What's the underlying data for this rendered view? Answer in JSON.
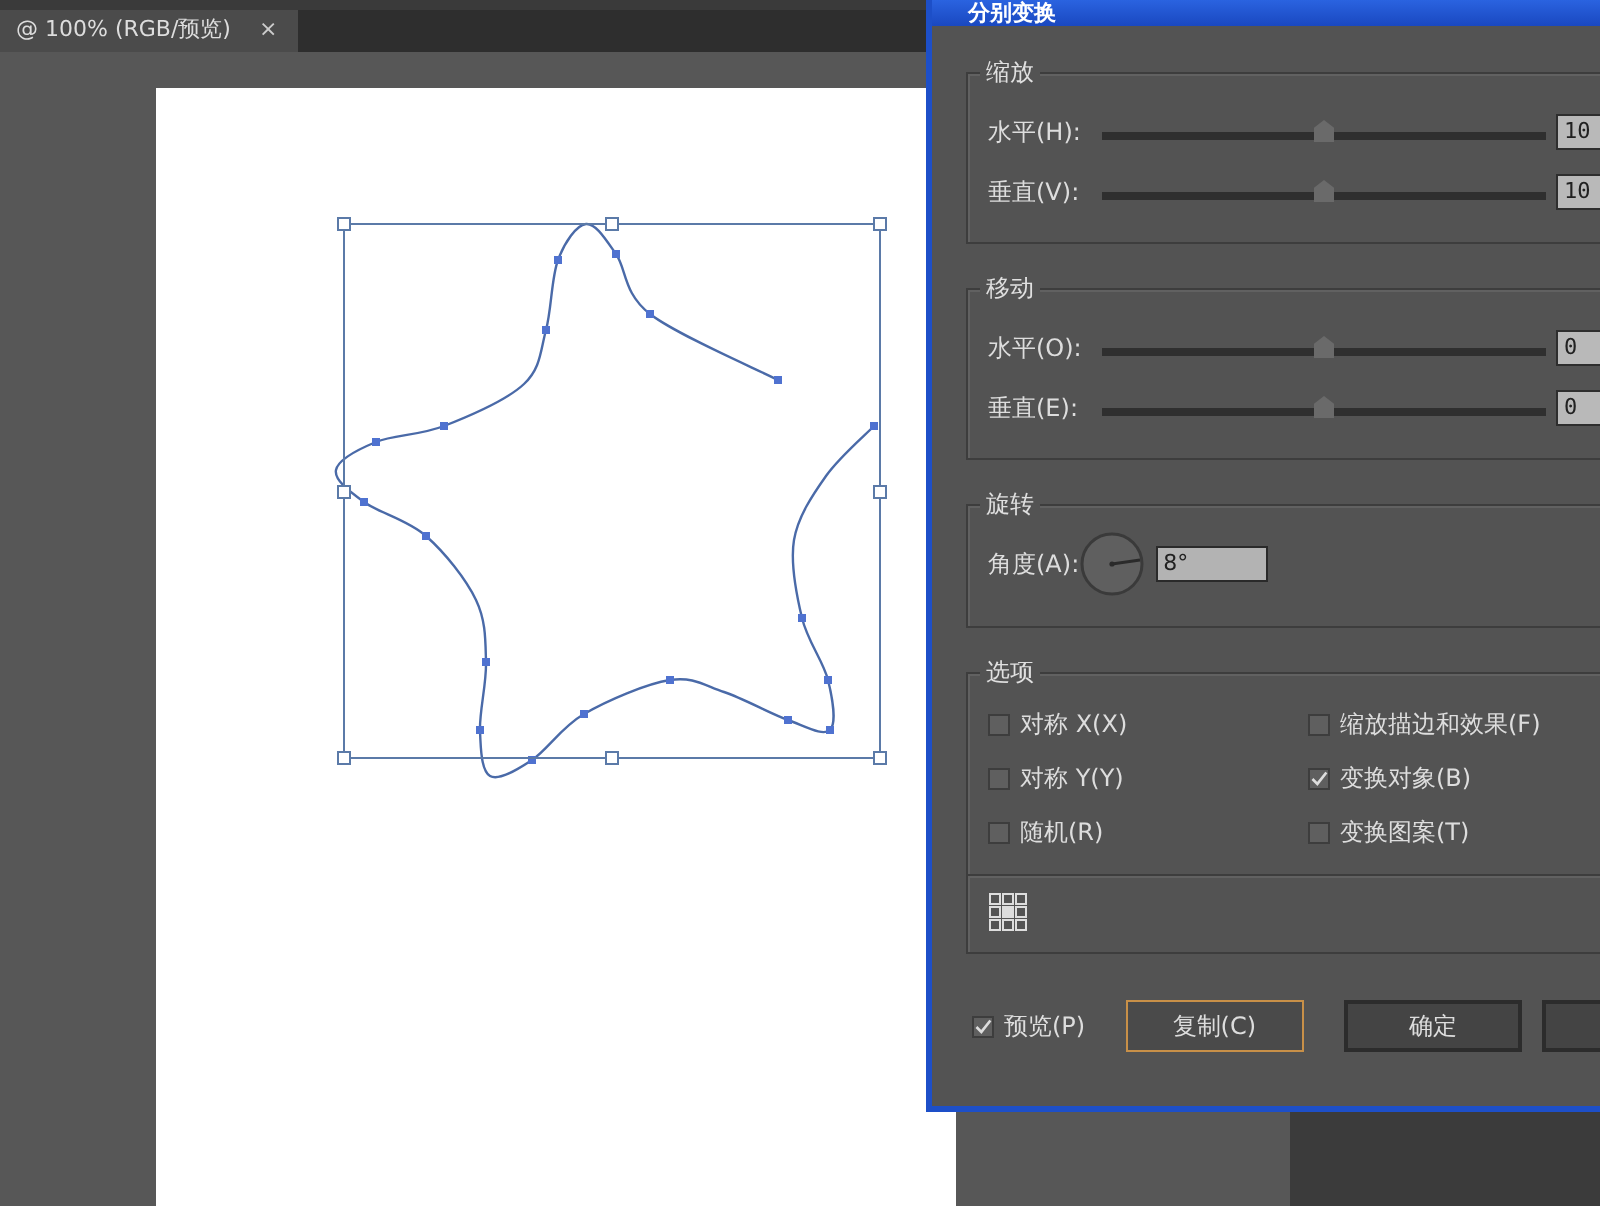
{
  "document_tab": {
    "label": "@ 100% (RGB/预览)",
    "close": "×"
  },
  "dialog": {
    "title": "分别变换",
    "scale": {
      "title": "缩放",
      "sliders": [
        {
          "label": "水平(H):",
          "level": 0.5,
          "value": "10"
        },
        {
          "label": "垂直(V):",
          "level": 0.5,
          "value": "10"
        }
      ]
    },
    "move": {
      "title": "移动",
      "sliders": [
        {
          "label": "水平(O):",
          "level": 0.5,
          "value": "0"
        },
        {
          "label": "垂直(E):",
          "level": 0.5,
          "value": "0"
        }
      ]
    },
    "rotate": {
      "title": "旋转",
      "label": "角度(A):",
      "value": "8°"
    },
    "options": {
      "title": "选项",
      "checkboxes": [
        {
          "label": "对称 X(X)",
          "checked": false
        },
        {
          "label": "缩放描边和效果(F)",
          "checked": false
        },
        {
          "label": "对称 Y(Y)",
          "checked": false
        },
        {
          "label": "变换对象(B)",
          "checked": true
        },
        {
          "label": "随机(R)",
          "checked": false
        },
        {
          "label": "变换图案(T)",
          "checked": false
        }
      ]
    },
    "preview": {
      "label": "预览(P)",
      "checked": true
    },
    "buttons": [
      {
        "label": "复制(C)",
        "focused": true
      },
      {
        "label": "确定",
        "focused": false
      }
    ]
  }
}
